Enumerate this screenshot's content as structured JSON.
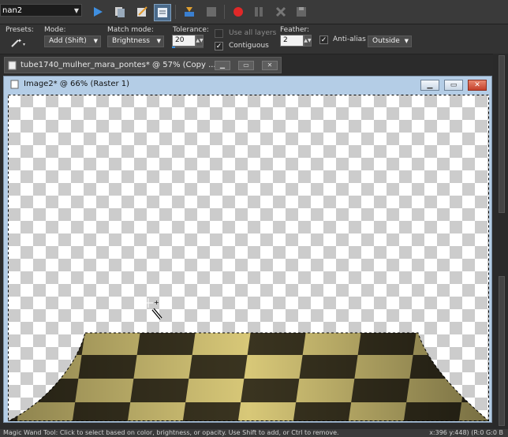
{
  "toolbar": {
    "script_name": "nan2",
    "icons": [
      "run-script-icon",
      "batch-icon",
      "edit-script-icon",
      "script-output-icon",
      "record-icon",
      "stop-icon",
      "record-circle-icon",
      "pause-icon",
      "cancel-icon",
      "save-script-icon"
    ]
  },
  "options": {
    "presets_label": "Presets:",
    "mode_label": "Mode:",
    "mode_value": "Add (Shift)",
    "match_mode_label": "Match mode:",
    "match_mode_value": "Brightness",
    "tolerance_label": "Tolerance:",
    "tolerance_value": "20",
    "use_all_layers_label": "Use all layers",
    "contiguous_label": "Contiguous",
    "feather_label": "Feather:",
    "feather_value": "2",
    "antialias_label": "Anti-alias",
    "antialias_value": "Outside"
  },
  "back_tab": {
    "title": "tube1740_mulher_mara_pontes* @  57% (Copy ..."
  },
  "window": {
    "title": "Image2* @  66% (Raster 1)"
  },
  "status": {
    "text": "Magic Wand Tool: Click to select based on color, brightness, or opacity. Use Shift to add, or Ctrl to remove.",
    "coords": "x:396 y:448) (R:0 G:0 B"
  },
  "colors": {
    "window_frame": "#b4cde6",
    "floor_light": "#d8c878",
    "floor_dark": "#3a3420",
    "record_red": "#e02828"
  }
}
